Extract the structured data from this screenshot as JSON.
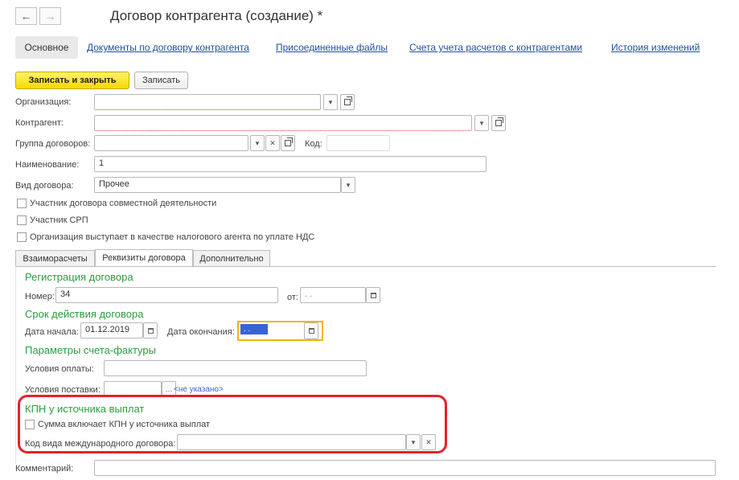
{
  "header": {
    "title": "Договор контрагента (создание) *",
    "back_icon": "←",
    "forward_icon": "→"
  },
  "nav_tabs": {
    "main": "Основное",
    "documents": "Документы по договору контрагента",
    "files": "Присоединенные файлы",
    "accounts": "Счета учета расчетов с контрагентами",
    "history": "История изменений"
  },
  "toolbar": {
    "save_close": "Записать и закрыть",
    "save": "Записать"
  },
  "form": {
    "organization_label": "Организация:",
    "organization_value": "",
    "counterparty_label": "Контрагент:",
    "counterparty_value": "",
    "group_label": "Группа договоров:",
    "group_value": "",
    "code_label": "Код:",
    "code_value": "",
    "name_label": "Наименование:",
    "name_value": "1",
    "type_label": "Вид договора:",
    "type_value": "Прочее",
    "checkbox_joint": "Участник договора совместной деятельности",
    "checkbox_srp": "Участник СРП",
    "checkbox_vat_agent": "Организация выступает в качестве налогового агента по уплате НДС"
  },
  "inner_tabs": {
    "settlements": "Взаиморасчеты",
    "requisites": "Реквизиты договора",
    "additional": "Дополнительно"
  },
  "registration": {
    "title": "Регистрация договора",
    "number_label": "Номер:",
    "number_value": "34",
    "from_label": "от:",
    "from_value": " .  .",
    "validity_title": "Срок действия договора",
    "start_label": "Дата начала:",
    "start_value": "01.12.2019",
    "end_label": "Дата окончания:",
    "end_value": " .  .",
    "invoice_title": "Параметры счета-фактуры",
    "payment_label": "Условия оплаты:",
    "payment_value": "",
    "delivery_label": "Условия поставки:",
    "delivery_value": "",
    "delivery_link": "<не указано>"
  },
  "kpn": {
    "title": "КПН у источника выплат",
    "checkbox_label": "Сумма включает КПН у источника выплат",
    "code_label": "Код вида международного договора:",
    "code_value": ""
  },
  "comment": {
    "label": "Комментарий:",
    "value": ""
  },
  "colors": {
    "section_green": "#2a9d3f",
    "link_blue": "#1f4f9f",
    "highlight_red": "#e8202a",
    "focus_yellow": "#f2b600",
    "primary_yellow": "#f6d900",
    "selection_blue": "#3a62d8"
  }
}
